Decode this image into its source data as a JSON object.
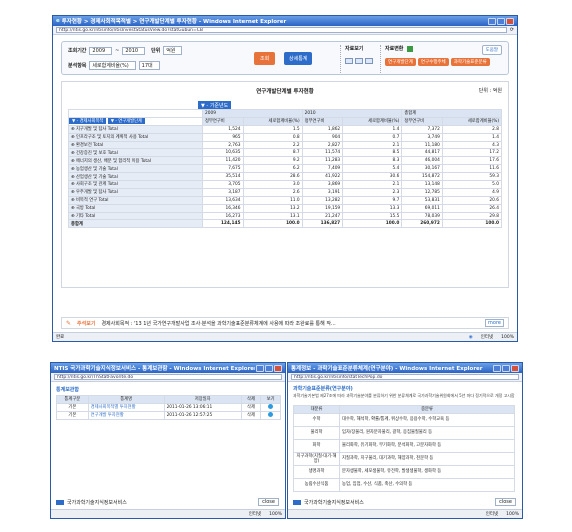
{
  "top_window": {
    "title": "투자현황 > 경제사회적목적별 > 연구개발단계별 투자현황 - Windows Internet Explorer",
    "address": "http://ntis.go.kr/ntisinfo/ntisInvestStatusView.do?statGubun=CB",
    "filters": {
      "period_label": "조회기간",
      "year_from": "2009",
      "tilde": "~",
      "year_to": "2010",
      "unit_label": "단위",
      "unit_value": "억원",
      "analysis_label": "분석항목",
      "analysis_value": "세로합계비율(%)",
      "rows_value": "17대"
    },
    "buttons": {
      "search": "조회",
      "detail": "상세통계",
      "row_label": "자료보기",
      "file_label": "자료변환",
      "help": "도움말",
      "opt1": "연구개발단계",
      "opt2": "연구수행주체",
      "opt3": "과학기술표준분류"
    },
    "report_title": "연구개발단계별 투자현황",
    "unit_note": "단위 : 억원",
    "pivot_col": "▼ - 기준년도",
    "header": {
      "row_dim1": "▼ - 경제사회목적",
      "row_dim2": "▼ - 연구개발단계",
      "years": [
        "2009",
        "2010",
        "총합계"
      ],
      "measures": [
        "정부연구비",
        "세로합계비율(%)"
      ]
    },
    "rows": [
      {
        "label": "⊕ 지구개발 및 탐사 Total",
        "v": [
          "1,524",
          "1.5",
          "1,862",
          "1.4",
          "7,372",
          "2.8"
        ]
      },
      {
        "label": "⊕ 인프라구조 및 토지의 계획적 사용 Total",
        "v": [
          "965",
          "0.8",
          "904",
          "0.7",
          "3,749",
          "1.4"
        ]
      },
      {
        "label": "⊕ 환경보전 Total",
        "v": [
          "2,763",
          "2.2",
          "2,827",
          "2.1",
          "11,180",
          "4.3"
        ]
      },
      {
        "label": "⊕ 건강증진 및 보호 Total",
        "v": [
          "10,635",
          "8.7",
          "11,574",
          "8.5",
          "44,817",
          "17.2"
        ]
      },
      {
        "label": "⊕ 에너지의 생산, 배분 및 합리적 이용 Total",
        "v": [
          "11,420",
          "9.2",
          "11,283",
          "8.3",
          "46,004",
          "17.6"
        ]
      },
      {
        "label": "⊕ 농업생산 및 기술 Total",
        "v": [
          "7,675",
          "6.2",
          "7,409",
          "5.4",
          "30,167",
          "11.6"
        ]
      },
      {
        "label": "⊕ 산업생산 및 기술 Total",
        "v": [
          "35,514",
          "28.6",
          "41,922",
          "30.6",
          "154,872",
          "59.3"
        ]
      },
      {
        "label": "⊕ 사회구조 및 관계 Total",
        "v": [
          "3,705",
          "3.0",
          "3,869",
          "2.1",
          "13,148",
          "5.0"
        ]
      },
      {
        "label": "⊕ 우주개발 및 탐사 Total",
        "v": [
          "3,187",
          "2.6",
          "3,191",
          "2.3",
          "12,785",
          "4.9"
        ]
      },
      {
        "label": "⊕ 비목적 연구 Total",
        "v": [
          "13,634",
          "11.0",
          "13,282",
          "9.7",
          "53,831",
          "20.6"
        ]
      },
      {
        "label": "⊕ 국방 Total",
        "v": [
          "16,346",
          "13.2",
          "19,159",
          "13.3",
          "69,011",
          "26.4"
        ]
      },
      {
        "label": "⊕ 기타 Total",
        "v": [
          "16,273",
          "13.1",
          "21,247",
          "15.5",
          "78,039",
          "29.8"
        ]
      },
      {
        "label": "총합계",
        "v": [
          "124,145",
          "100.0",
          "136,827",
          "100.0",
          "260,972",
          "100.0"
        ]
      }
    ],
    "note_label": "주석보기",
    "note_text": "경제사회목적 : '13 1년 국가연구개발사업 조사·분석을 과학기술표준분류체계에 사용에 따라 조완료를 통해 작...",
    "note_more": "more",
    "status_left": "완료",
    "status_zone": "인터넷",
    "status_zoom": "100%"
  },
  "bl_window": {
    "title": "NTIS 국가과학기술지식정보서비스 - 통계보관함 - Windows Internet Explorer",
    "address": "http://ntis.go.kr/ThStatFavorite.do",
    "section": "통계보관함",
    "cols": [
      "통계구분",
      "통계명",
      "저장일자",
      "삭제",
      "보기"
    ],
    "rows": [
      {
        "type": "기본",
        "name": "경제사회목적별 투자현황",
        "date": "2011-01-26 13:06:11",
        "del": "삭제"
      },
      {
        "type": "기본",
        "name": "연구개발 투자현황",
        "date": "2011-01-26 12:57:25",
        "del": "삭제"
      }
    ],
    "footer": "국가과학기술지식정보서비스",
    "close": "close",
    "status_zone": "인터넷",
    "status_zoom": "100%"
  },
  "br_window": {
    "title": "통계정보 - 과학기술표준분류체계(연구분야) - Windows Internet Explorer",
    "address": "http://ntis.go.kr/ntisinfo/statTechPop.do",
    "section": "과학기술표준분류(연구분야)",
    "intro": "과학기술기본법 제27조에 따라 과학기술분야를 분류하기 위한 분류체계로 국가과학기술위원회에서 5년 마다 정기적으로 개정 고시함",
    "cols": [
      "대분류",
      "중분류"
    ],
    "rows": [
      {
        "c": "수학",
        "d": "대수학, 해석학, 확률/통계, 위상수학, 응용수학, 수학교육 등"
      },
      {
        "c": "물리학",
        "d": "입자/장물리, 원자분자물리, 광학, 응집물질물리 등"
      },
      {
        "c": "화학",
        "d": "물리화학, 유기화학, 무기화학, 분석화학, 고분자화학 등"
      },
      {
        "c": "지구과학(지질·대기·해양)",
        "d": "지질과학, 지구물리, 대기과학, 해양과학, 천문학 등"
      },
      {
        "c": "생명과학",
        "d": "분자생물학, 세포생물학, 유전학, 발생생물학, 생화학 등"
      },
      {
        "c": "농림수산식품",
        "d": "농업, 임업, 수산, 식품, 축산, 수의학 등"
      }
    ],
    "footer": "국가과학기술지식정보서비스",
    "close": "close",
    "status_zone": "인터넷",
    "status_zoom": "100%"
  },
  "colors": {
    "titlebar": "#2b63c4",
    "accent": "#2d6dc9",
    "orange": "#e8733a",
    "header_bg": "#dbe4f2"
  }
}
